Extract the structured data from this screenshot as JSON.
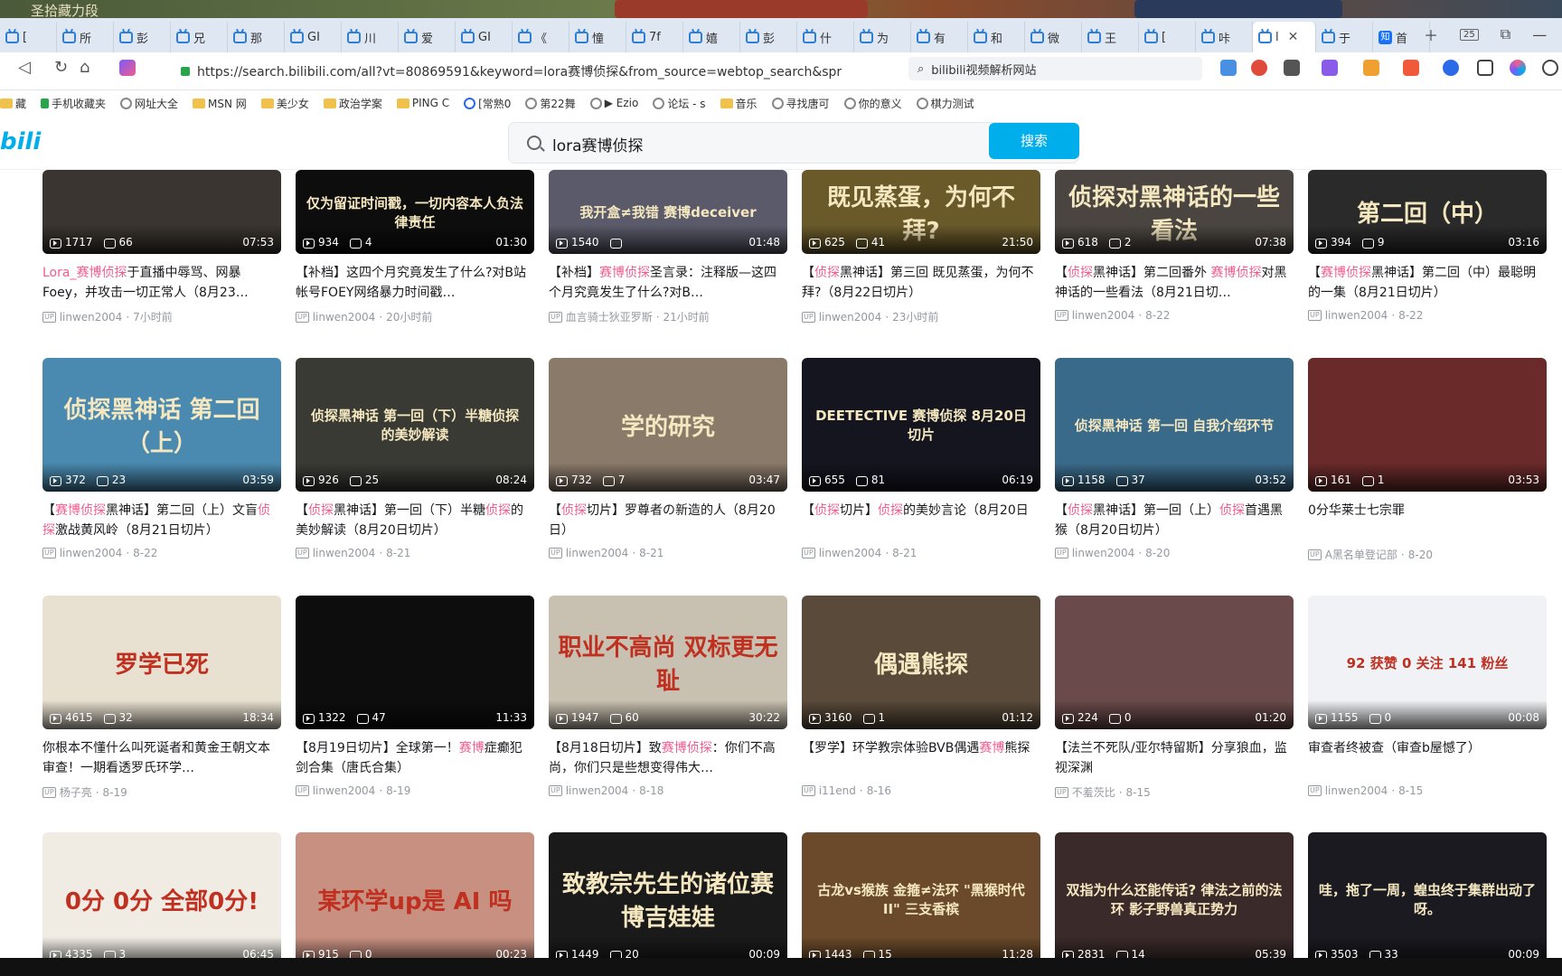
{
  "window": {
    "title_fragment": "圣拾藏力段"
  },
  "tabs": [
    {
      "label": "["
    },
    {
      "label": "所"
    },
    {
      "label": "彭"
    },
    {
      "label": "兄"
    },
    {
      "label": "那"
    },
    {
      "label": "GI"
    },
    {
      "label": "川"
    },
    {
      "label": "爱"
    },
    {
      "label": "GI"
    },
    {
      "label": "《"
    },
    {
      "label": "憧"
    },
    {
      "label": "7f"
    },
    {
      "label": "嬉"
    },
    {
      "label": "彭"
    },
    {
      "label": "什"
    },
    {
      "label": "为"
    },
    {
      "label": "有"
    },
    {
      "label": "和"
    },
    {
      "label": "微"
    },
    {
      "label": "王"
    },
    {
      "label": "["
    },
    {
      "label": "咔"
    },
    {
      "label": "l"
    },
    {
      "label": "于"
    },
    {
      "label": "首"
    }
  ],
  "tab_controls": {
    "count": "25"
  },
  "address": {
    "url": "https://search.bilibili.com/all?vt=80869591&keyword=lora赛博侦探&from_source=webtop_search&spr",
    "search_engine_text": "bilibili视频解析网站"
  },
  "bookmarks": [
    {
      "label": "藏",
      "icon": "folder-icon"
    },
    {
      "label": "手机收藏夹",
      "icon": "phone-icon"
    },
    {
      "label": "网址大全",
      "icon": "globe-icon"
    },
    {
      "label": "MSN 网",
      "icon": "folder-icon"
    },
    {
      "label": "美少女",
      "icon": "folder-icon"
    },
    {
      "label": "政治学案",
      "icon": "folder-icon"
    },
    {
      "label": "PING C",
      "icon": "folder-icon"
    },
    {
      "label": "[常熟0",
      "icon": "hand-icon"
    },
    {
      "label": "第22舞",
      "icon": "globe-icon"
    },
    {
      "label": "▶ Ezio",
      "icon": "globe-icon"
    },
    {
      "label": "论坛 - s",
      "icon": "globe-icon"
    },
    {
      "label": "音乐",
      "icon": "folder-icon"
    },
    {
      "label": "寻找唐可",
      "icon": "globe-icon"
    },
    {
      "label": "你的意义",
      "icon": "globe-icon"
    },
    {
      "label": "棋力测试",
      "icon": "globe-icon"
    }
  ],
  "site": {
    "logo": "bili",
    "search_query": "lora赛博侦探",
    "search_button": "搜索"
  },
  "colors": {
    "accent": "#00aeec",
    "highlight": "#f25d8e"
  },
  "videos": [
    {
      "bg": "#3a3530",
      "caption": "",
      "views": "1717",
      "danmaku": "66",
      "duration": "07:53",
      "title_parts": [
        {
          "t": "Lora_",
          "hl": true
        },
        {
          "t": "赛博侦探",
          "hl": true
        },
        {
          "t": "于直播中辱骂、网暴Foey，并攻击一切正常人（8月23…",
          "hl": false
        }
      ],
      "uploader": "linwen2004",
      "date": "7小时前"
    },
    {
      "bg": "#0d0d0d",
      "caption": "仅为留证时间戳，一切内容本人负法律责任",
      "views": "934",
      "danmaku": "4",
      "duration": "01:30",
      "title_parts": [
        {
          "t": "【补档】这四个月究竟发生了什么?对B站帐号FOEY网络暴力时间戳…",
          "hl": false
        }
      ],
      "uploader": "linwen2004",
      "date": "20小时前"
    },
    {
      "bg": "#5a5a6a",
      "caption": "我开盒≠我错 赛博deceiver",
      "views": "1540",
      "danmaku": "",
      "duration": "01:48",
      "title_parts": [
        {
          "t": "【补档】",
          "hl": false
        },
        {
          "t": "赛博侦探",
          "hl": true
        },
        {
          "t": "圣言录：注释版—这四个月究竟发生了什么?对B…",
          "hl": false
        }
      ],
      "uploader": "血言骑士狄亚罗斯",
      "date": "21小时前"
    },
    {
      "bg": "#6a5a2a",
      "caption": "既见蒸蛋，为何不拜?",
      "views": "625",
      "danmaku": "41",
      "duration": "21:50",
      "title_parts": [
        {
          "t": "【",
          "hl": false
        },
        {
          "t": "侦探",
          "hl": true
        },
        {
          "t": "黑神话】第三回 既见蒸蛋，为何不拜?（8月22日切片）",
          "hl": false
        }
      ],
      "uploader": "linwen2004",
      "date": "23小时前"
    },
    {
      "bg": "#4a4540",
      "caption": "侦探对黑神话的一些看法",
      "views": "618",
      "danmaku": "2",
      "duration": "07:38",
      "title_parts": [
        {
          "t": "【",
          "hl": false
        },
        {
          "t": "侦探",
          "hl": true
        },
        {
          "t": "黑神话】第二回番外 ",
          "hl": false
        },
        {
          "t": "赛博侦探",
          "hl": true
        },
        {
          "t": "对黑神话的一些看法（8月21日切…",
          "hl": false
        }
      ],
      "uploader": "linwen2004",
      "date": "8-22"
    },
    {
      "bg": "#2a2a2a",
      "caption": "第二回（中）",
      "views": "394",
      "danmaku": "9",
      "duration": "03:16",
      "title_parts": [
        {
          "t": "【",
          "hl": false
        },
        {
          "t": "赛博侦探",
          "hl": true
        },
        {
          "t": "黑神话】第二回（中）最聪明的一集（8月21日切片）",
          "hl": false
        }
      ],
      "uploader": "linwen2004",
      "date": "8-22"
    },
    {
      "bg": "#4a8ab0",
      "caption": "侦探黑神话 第二回（上）",
      "views": "372",
      "danmaku": "23",
      "duration": "03:59",
      "title_parts": [
        {
          "t": "【",
          "hl": false
        },
        {
          "t": "赛博侦探",
          "hl": true
        },
        {
          "t": "黑神话】第二回（上）文盲",
          "hl": false
        },
        {
          "t": "侦探",
          "hl": true
        },
        {
          "t": "激战黄风岭（8月21日切片）",
          "hl": false
        }
      ],
      "uploader": "linwen2004",
      "date": "8-22"
    },
    {
      "bg": "#3a3a35",
      "caption": "侦探黑神话 第一回（下）半糖侦探的美妙解读",
      "views": "926",
      "danmaku": "25",
      "duration": "08:24",
      "title_parts": [
        {
          "t": "【",
          "hl": false
        },
        {
          "t": "侦探",
          "hl": true
        },
        {
          "t": "黑神话】第一回（下）半糖",
          "hl": false
        },
        {
          "t": "侦探",
          "hl": true
        },
        {
          "t": "的美妙解读（8月20日切片）",
          "hl": false
        }
      ],
      "uploader": "linwen2004",
      "date": "8-21"
    },
    {
      "bg": "#8a7a6a",
      "caption": "学的研究",
      "views": "732",
      "danmaku": "7",
      "duration": "03:47",
      "title_parts": [
        {
          "t": "【",
          "hl": false
        },
        {
          "t": "侦探",
          "hl": true
        },
        {
          "t": "切片】罗尊者の新造的人（8月20日）",
          "hl": false
        }
      ],
      "uploader": "linwen2004",
      "date": "8-21"
    },
    {
      "bg": "#151520",
      "caption": "DEETECTIVE 赛博侦探 8月20日切片",
      "views": "655",
      "danmaku": "81",
      "duration": "06:19",
      "title_parts": [
        {
          "t": "【",
          "hl": false
        },
        {
          "t": "侦探",
          "hl": true
        },
        {
          "t": "切片】",
          "hl": false
        },
        {
          "t": "侦探",
          "hl": true
        },
        {
          "t": "的美妙言论（8月20日",
          "hl": false
        }
      ],
      "uploader": "linwen2004",
      "date": "8-21"
    },
    {
      "bg": "#3a6a8a",
      "caption": "侦探黑神话 第一回 自我介绍环节",
      "views": "1158",
      "danmaku": "37",
      "duration": "03:52",
      "title_parts": [
        {
          "t": "【",
          "hl": false
        },
        {
          "t": "侦探",
          "hl": true
        },
        {
          "t": "黑神话】第一回（上）",
          "hl": false
        },
        {
          "t": "侦探",
          "hl": true
        },
        {
          "t": "首遇黑猴（8月20日切片）",
          "hl": false
        }
      ],
      "uploader": "linwen2004",
      "date": "8-20"
    },
    {
      "bg": "#6a2a2a",
      "caption": "",
      "views": "161",
      "danmaku": "1",
      "duration": "03:53",
      "title_parts": [
        {
          "t": "0分华莱士七宗罪",
          "hl": false
        }
      ],
      "uploader": "A黑名单登记部",
      "date": "8-20"
    },
    {
      "bg": "#e8e0d0",
      "caption": "罗学已死",
      "views": "4615",
      "danmaku": "32",
      "duration": "18:34",
      "title_parts": [
        {
          "t": "你根本不懂什么叫死诞者和黄金王朝文本审查！一期看透罗氏环学…",
          "hl": false
        }
      ],
      "uploader": "杨子亮",
      "date": "8-19"
    },
    {
      "bg": "#0d0d0d",
      "caption": "",
      "views": "1322",
      "danmaku": "47",
      "duration": "11:33",
      "title_parts": [
        {
          "t": "【8月19日切片】全球第一！",
          "hl": false
        },
        {
          "t": "赛博",
          "hl": true
        },
        {
          "t": "症癫犯剑合集（唐氏合集）",
          "hl": false
        }
      ],
      "uploader": "linwen2004",
      "date": "8-19"
    },
    {
      "bg": "#c8c0b0",
      "caption": "职业不高尚 双标更无耻",
      "views": "1947",
      "danmaku": "60",
      "duration": "30:22",
      "title_parts": [
        {
          "t": "【8月18日切片】致",
          "hl": false
        },
        {
          "t": "赛博侦探",
          "hl": true
        },
        {
          "t": "：你们不高尚，你们只是些想变得伟大…",
          "hl": false
        }
      ],
      "uploader": "linwen2004",
      "date": "8-18"
    },
    {
      "bg": "#5a4a3a",
      "caption": "偶遇熊探",
      "views": "3160",
      "danmaku": "1",
      "duration": "01:12",
      "title_parts": [
        {
          "t": "【罗学】环学教宗体验BVB偶遇",
          "hl": false
        },
        {
          "t": "赛博",
          "hl": true
        },
        {
          "t": "熊探",
          "hl": false
        }
      ],
      "uploader": "i11end",
      "date": "8-16"
    },
    {
      "bg": "#6a4a4a",
      "caption": "",
      "views": "224",
      "danmaku": "0",
      "duration": "01:20",
      "title_parts": [
        {
          "t": "【法兰不死队/亚尔特留斯】分享狼血，监视深渊",
          "hl": false
        }
      ],
      "uploader": "不羞茨比",
      "date": "8-15"
    },
    {
      "bg": "#f0f2f5",
      "caption": "92 获赞 0 关注 141 粉丝",
      "views": "1155",
      "danmaku": "0",
      "duration": "00:08",
      "title_parts": [
        {
          "t": "审查者终被查（审查b屋憾了）",
          "hl": false
        }
      ],
      "uploader": "linwen2004",
      "date": "8-15"
    },
    {
      "bg": "#f0ece4",
      "caption": "0分 0分 全部0分!",
      "views": "4335",
      "danmaku": "3",
      "duration": "06:45",
      "title_parts": [],
      "uploader": "",
      "date": ""
    },
    {
      "bg": "#c89080",
      "caption": "某环学up是 AI 吗",
      "views": "915",
      "danmaku": "0",
      "duration": "00:23",
      "title_parts": [],
      "uploader": "",
      "date": ""
    },
    {
      "bg": "#1a1a1a",
      "caption": "致教宗先生的诸位赛博吉娃娃",
      "views": "1449",
      "danmaku": "20",
      "duration": "00:09",
      "title_parts": [],
      "uploader": "",
      "date": ""
    },
    {
      "bg": "#6a4a2a",
      "caption": "古龙vs猴族 金箍≠法环 \"黑猴时代II\" 三支香槟",
      "views": "1443",
      "danmaku": "15",
      "duration": "11:28",
      "title_parts": [],
      "uploader": "",
      "date": ""
    },
    {
      "bg": "#3a2a2a",
      "caption": "双指为什么还能传话? 律法之前的法环 影子野兽真正势力",
      "views": "2831",
      "danmaku": "14",
      "duration": "05:39",
      "title_parts": [],
      "uploader": "",
      "date": ""
    },
    {
      "bg": "#1a1a20",
      "caption": "哇，拖了一周，蝗虫终于集群出动了呀。",
      "views": "3503",
      "danmaku": "33",
      "duration": "00:09",
      "title_parts": [],
      "uploader": "",
      "date": ""
    }
  ]
}
